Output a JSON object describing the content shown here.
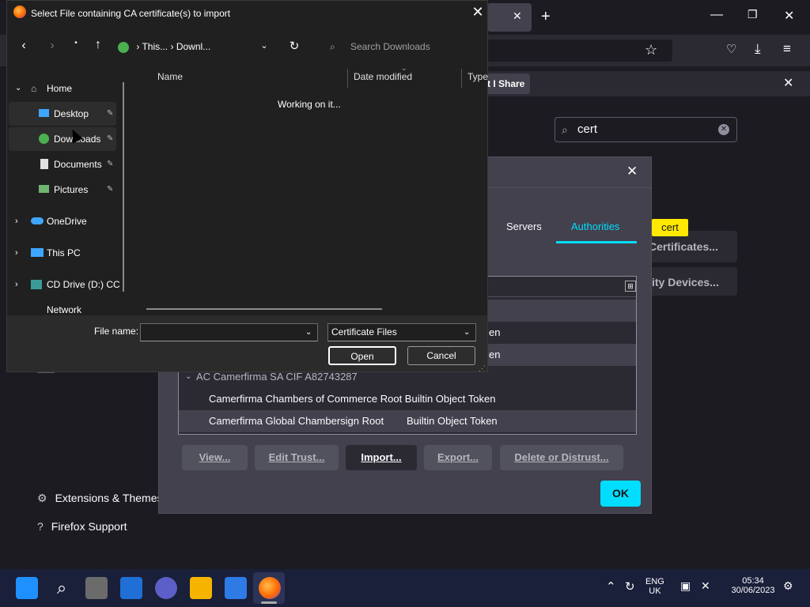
{
  "firefox": {
    "notification_button": "t I Share",
    "search_value": "cert",
    "highlight_tag": "cert",
    "certificates_button": "Certificates...",
    "security_devices_button": "ity Devices...",
    "sidebar": {
      "extensions": "Extensions & Themes",
      "support": "Firefox Support"
    }
  },
  "cert_manager": {
    "tabs": {
      "servers": "Servers",
      "authorities": "Authorities"
    },
    "rows": [
      {
        "text": "en"
      },
      {
        "text": "en"
      },
      {
        "text": "AC Camerfirma SA CIF A82743287"
      },
      {
        "text": "Camerfirma Chambers of Commerce Root Builtin Object Token"
      },
      {
        "name": "Camerfirma Global Chambersign Root",
        "device": "Builtin Object Token"
      }
    ],
    "buttons": {
      "view": "View...",
      "edit_trust": "Edit Trust...",
      "import": "Import...",
      "export": "Export...",
      "delete": "Delete or Distrust...",
      "ok": "OK"
    }
  },
  "file_dialog": {
    "title": "Select File containing CA certificate(s) to import",
    "breadcrumb": {
      "part1": "This...",
      "part2": "Downl..."
    },
    "search_placeholder": "Search Downloads",
    "tree": {
      "home": "Home",
      "desktop": "Desktop",
      "downloads": "Downloads",
      "documents": "Documents",
      "pictures": "Pictures",
      "onedrive": "OneDrive",
      "thispc": "This PC",
      "cddrive": "CD Drive (D:) CCC",
      "network": "Network"
    },
    "columns": {
      "name": "Name",
      "date": "Date modified",
      "type": "Type"
    },
    "status": "Working on it...",
    "file_name_label": "File name:",
    "file_name_value": "",
    "filter": "Certificate Files",
    "open": "Open",
    "cancel": "Cancel"
  },
  "taskbar": {
    "lang1": "ENG",
    "lang2": "UK",
    "time": "05:34",
    "date": "30/06/2023"
  },
  "colors": {
    "accent": "#00ddff",
    "firefox_dark": "#1c1b22",
    "dialog": "#42414d"
  }
}
